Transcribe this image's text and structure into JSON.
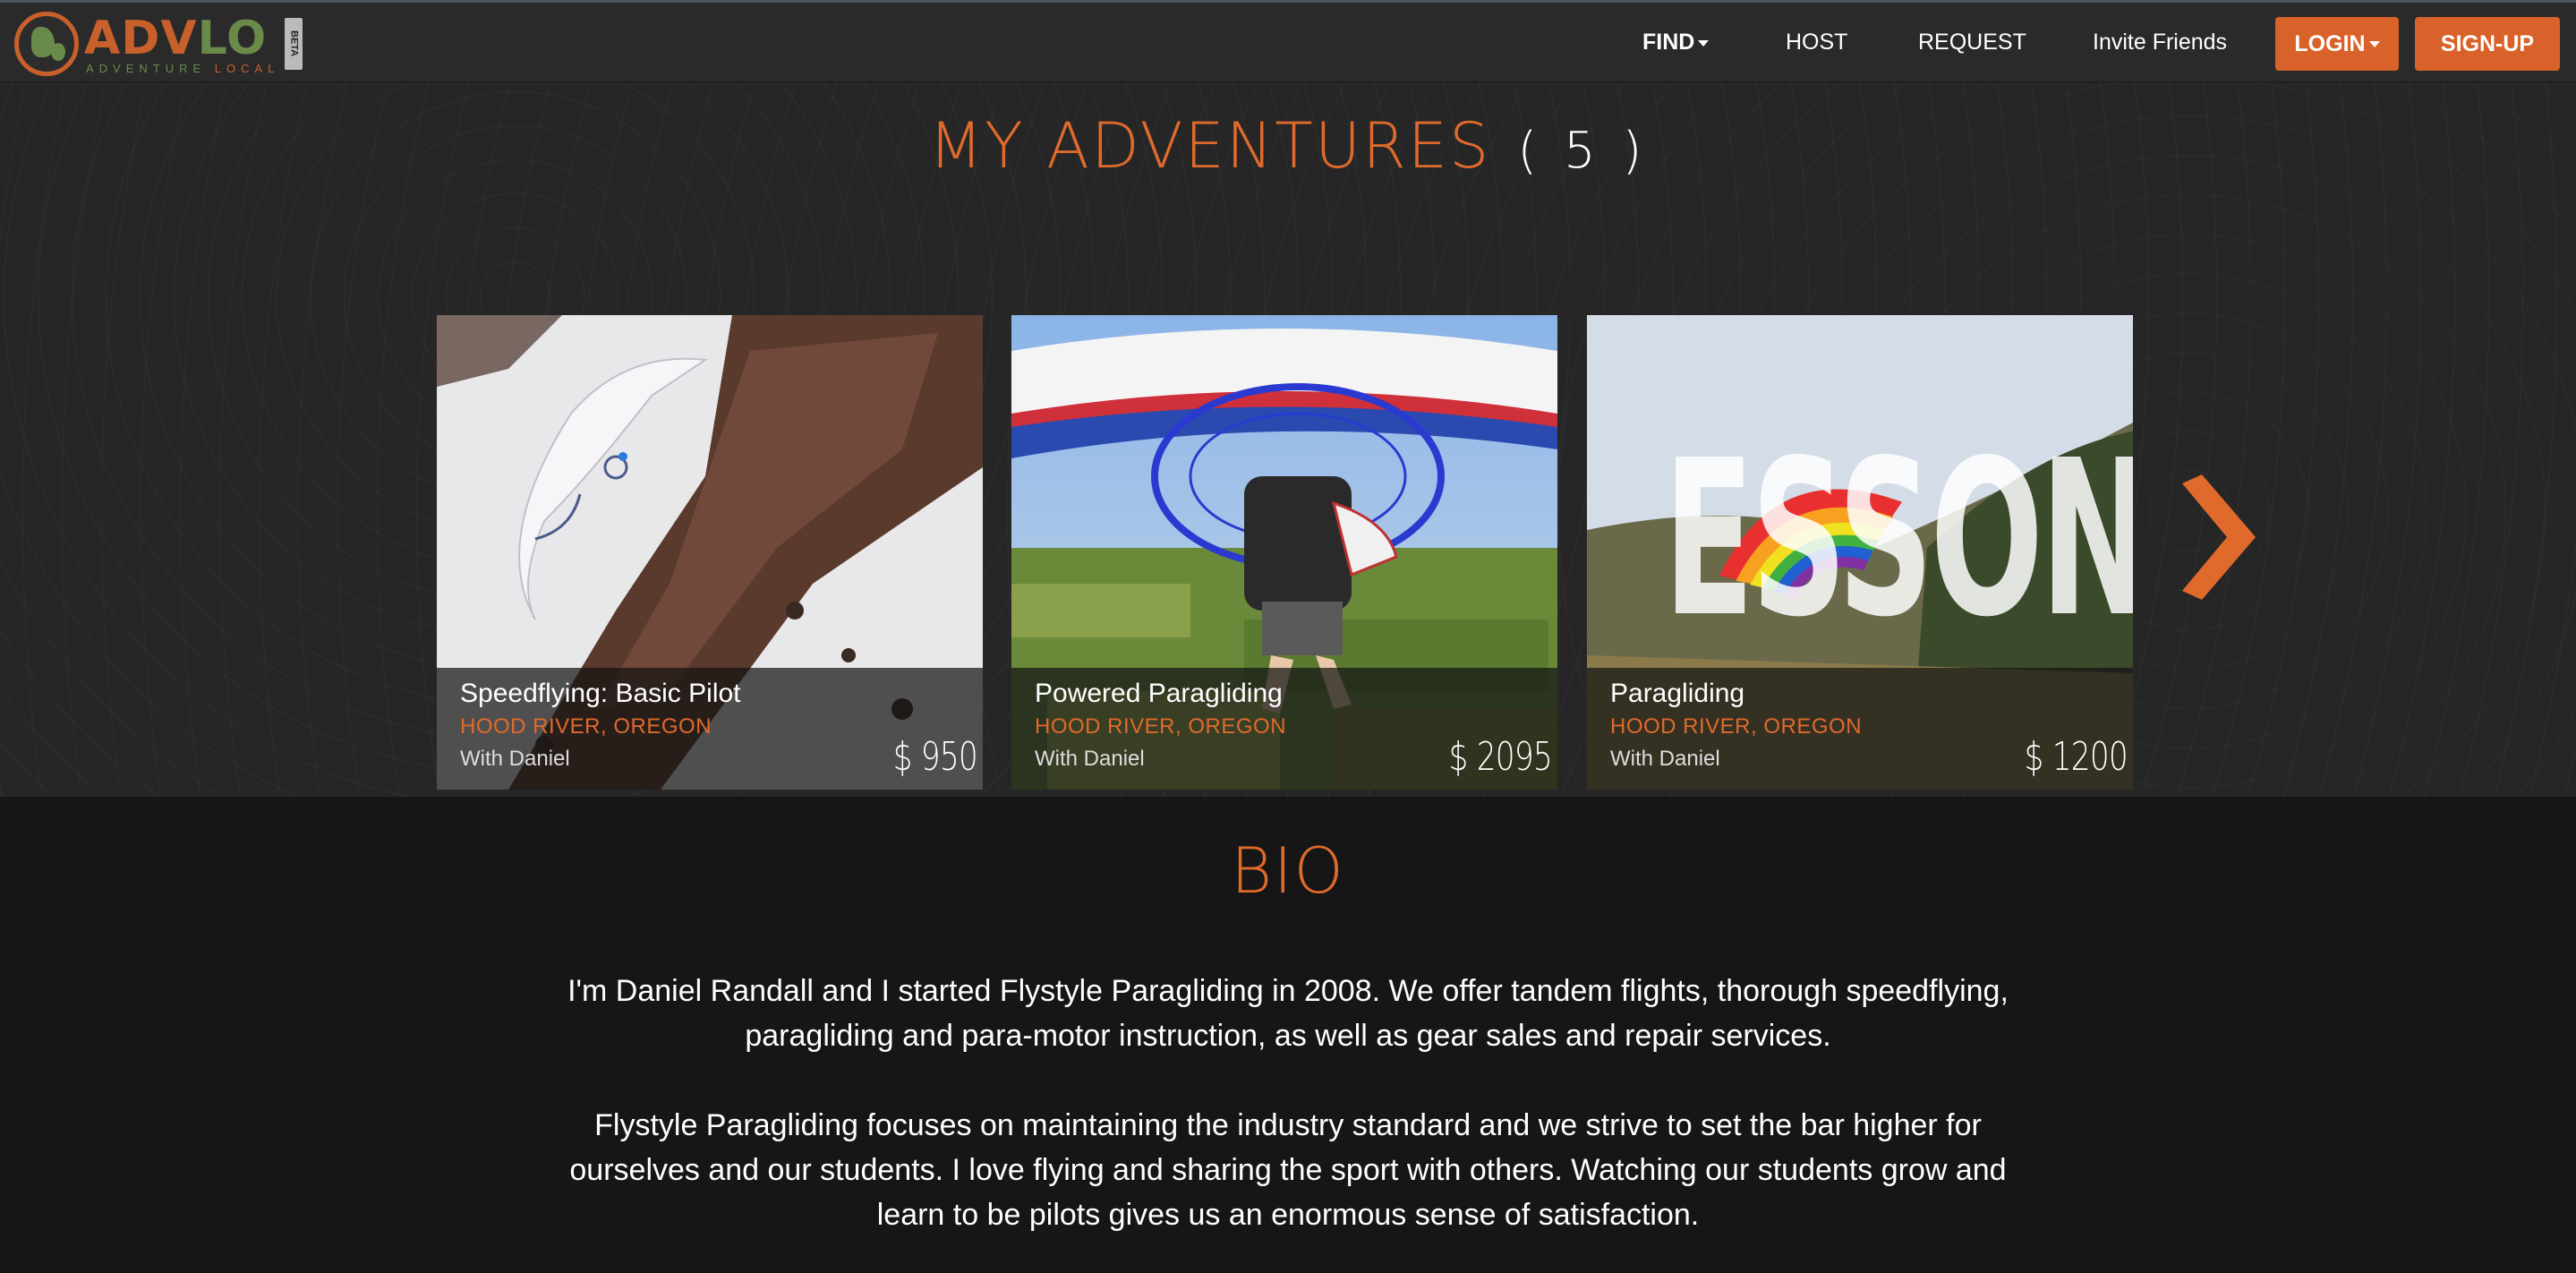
{
  "nav": {
    "logo_text_a": "ADV",
    "logo_text_b": "LO",
    "logo_tagline_a": "ADVENTURE ",
    "logo_tagline_b": "LOCAL",
    "beta_badge": "BETA",
    "find_label": "FIND",
    "host_label": "HOST",
    "request_label": "REQUEST",
    "invite_label": "Invite Friends",
    "login_label": "LOGIN",
    "signup_label": "SIGN-UP"
  },
  "adventures": {
    "title": "MY ADVENTURES",
    "count": "( 5 )",
    "cards": [
      {
        "title": "Speedflying: Basic Pilot",
        "location": "HOOD RIVER, OREGON",
        "host": "With Daniel",
        "price": "$ 950"
      },
      {
        "title": "Powered Paragliding",
        "location": "HOOD RIVER, OREGON",
        "host": "With Daniel",
        "price": "$ 2095"
      },
      {
        "title": "Paragliding",
        "location": "HOOD RIVER, OREGON",
        "host": "With Daniel",
        "price": "$ 1200",
        "image_text": "ESSON"
      }
    ]
  },
  "bio": {
    "title": "BIO",
    "paragraph1_line1": "I'm Daniel Randall and I started Flystyle Paragliding in 2008. We offer tandem flights, thorough speedflying,",
    "paragraph1_line2": "paragliding and para-motor instruction, as well as gear sales and repair services.",
    "paragraph2_line1": "Flystyle Paragliding focuses on maintaining the industry standard and we strive to set the bar higher for",
    "paragraph2_line2": "ourselves and our students. I love flying and sharing the sport with others. Watching our students grow and",
    "paragraph2_line3": "learn to be pilots gives us an enormous sense of satisfaction."
  },
  "colors": {
    "accent": "#e06a2c",
    "button": "#d8622a",
    "nav_bg": "#2a2a2a",
    "section_bg": "#262626",
    "bio_bg": "#161616",
    "logo_green": "#6a8a4a"
  },
  "icons": [
    "globe-logo-icon",
    "caret-down-icon",
    "chevron-right-icon"
  ]
}
